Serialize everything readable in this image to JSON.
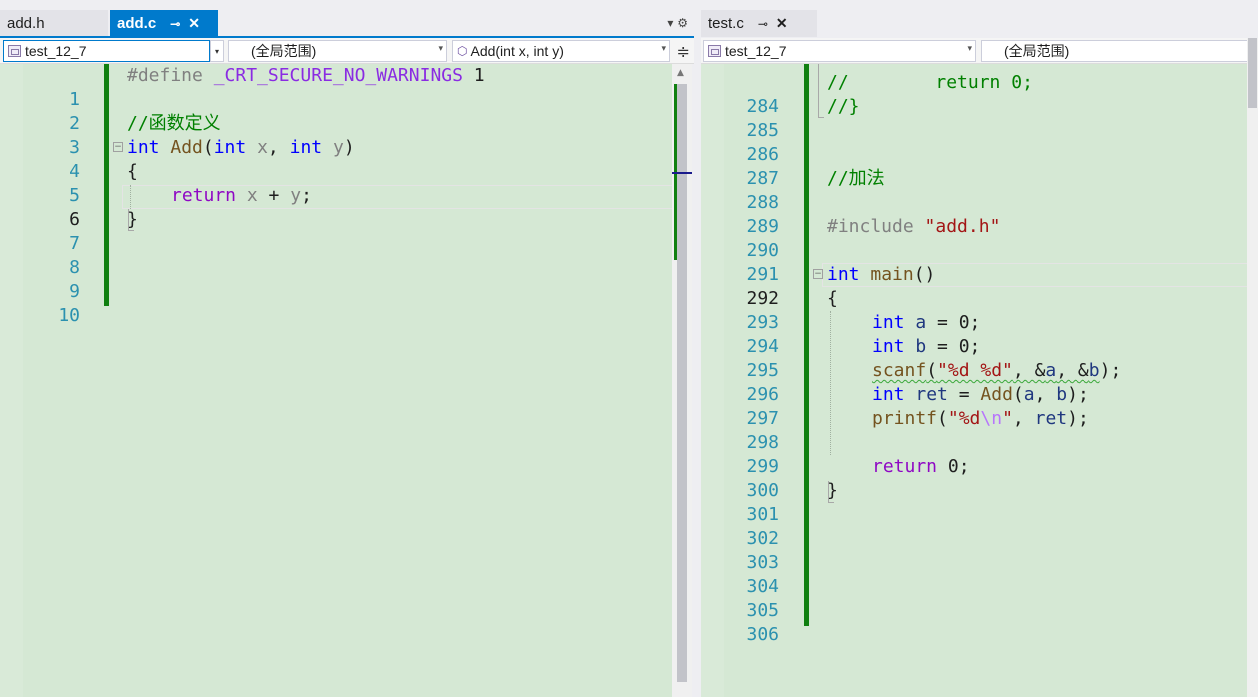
{
  "left_pane": {
    "tabs": [
      {
        "label": "add.h",
        "active": false
      },
      {
        "label": "add.c",
        "active": true,
        "pin": "⊸",
        "close": "✕"
      }
    ],
    "tools": "▾ ⚙",
    "nav": {
      "project": "test_12_7",
      "scope": "(全局范围)",
      "member": "Add(int x, int y)"
    },
    "lines": [
      {
        "num": "1"
      },
      {
        "num": "2"
      },
      {
        "num": "3"
      },
      {
        "num": "4"
      },
      {
        "num": "5"
      },
      {
        "num": "6"
      },
      {
        "num": "7"
      },
      {
        "num": "8"
      },
      {
        "num": "9"
      },
      {
        "num": "10"
      }
    ],
    "code": {
      "l1_pp": "#define",
      "l1_macro": "_CRT_SECURE_NO_WARNINGS",
      "l1_val": "1",
      "l3_comment": "//函数定义",
      "l4_int1": "int",
      "l4_fn": "Add",
      "l4_open": "(",
      "l4_int2": "int",
      "l4_x": "x",
      "l4_comma": ", ",
      "l4_int3": "int",
      "l4_y": "y",
      "l4_close": ")",
      "l5_brace": "{",
      "l6_return": "return",
      "l6_x": "x",
      "l6_plus": " + ",
      "l6_y": "y",
      "l6_semi": ";",
      "l7_brace": "}"
    }
  },
  "right_pane": {
    "tabs": [
      {
        "label": "test.c",
        "active": false,
        "pin": "⊸",
        "close": "✕"
      }
    ],
    "nav": {
      "project": "test_12_7",
      "scope": "(全局范围)"
    },
    "lines": [
      {
        "num": "284"
      },
      {
        "num": "285"
      },
      {
        "num": "286"
      },
      {
        "num": "287"
      },
      {
        "num": "288"
      },
      {
        "num": "289"
      },
      {
        "num": "290"
      },
      {
        "num": "291"
      },
      {
        "num": "292"
      },
      {
        "num": "293"
      },
      {
        "num": "294"
      },
      {
        "num": "295"
      },
      {
        "num": "296"
      },
      {
        "num": "297"
      },
      {
        "num": "298"
      },
      {
        "num": "299"
      },
      {
        "num": "300"
      },
      {
        "num": "301"
      },
      {
        "num": "302"
      },
      {
        "num": "303"
      },
      {
        "num": "304"
      },
      {
        "num": "305"
      },
      {
        "num": "306"
      }
    ],
    "code": {
      "l284_cm": "//        return 0;",
      "l285_cm": "//}",
      "l288_cm": "//加法",
      "l290_pp": "#include",
      "l290_str": "\"add.h\"",
      "l292_int": "int",
      "l292_fn": "main",
      "l292_par": "()",
      "l293_brace": "{",
      "l294_int": "int",
      "l294_a": "a",
      "l294_rest": " = 0;",
      "l295_int": "int",
      "l295_b": "b",
      "l295_rest": " = 0;",
      "l296_fn": "scanf",
      "l296_open": "(",
      "l296_str": "\"%d %d\"",
      "l296_c1": ", &",
      "l296_a": "a",
      "l296_c2": ", &",
      "l296_b": "b",
      "l296_close": ");",
      "l297_int": "int",
      "l297_ret": "ret",
      "l297_eq": " = ",
      "l297_fn": "Add",
      "l297_open": "(",
      "l297_a": "a",
      "l297_comma": ", ",
      "l297_b": "b",
      "l297_close": ");",
      "l298_fn": "printf",
      "l298_open": "(",
      "l298_str1": "\"%d",
      "l298_esc": "\\n",
      "l298_str2": "\"",
      "l298_comma": ", ",
      "l298_ret": "ret",
      "l298_close": ");",
      "l300_return": "return",
      "l300_rest": " 0;",
      "l301_brace": "}"
    }
  },
  "colors": {
    "editor_bg": "#d5e8d4",
    "accent": "#007acc",
    "change_bar": "#108010",
    "line_number": "#2b91af",
    "keyword": "#0000ff",
    "control_keyword": "#8f08c4",
    "string": "#a31515",
    "comment": "#008000",
    "function": "#74531f"
  },
  "icons": {
    "tab_pin": "pin-icon",
    "tab_close": "close-icon",
    "split_view": "split-editor-icon",
    "member": "method-cube-icon"
  }
}
